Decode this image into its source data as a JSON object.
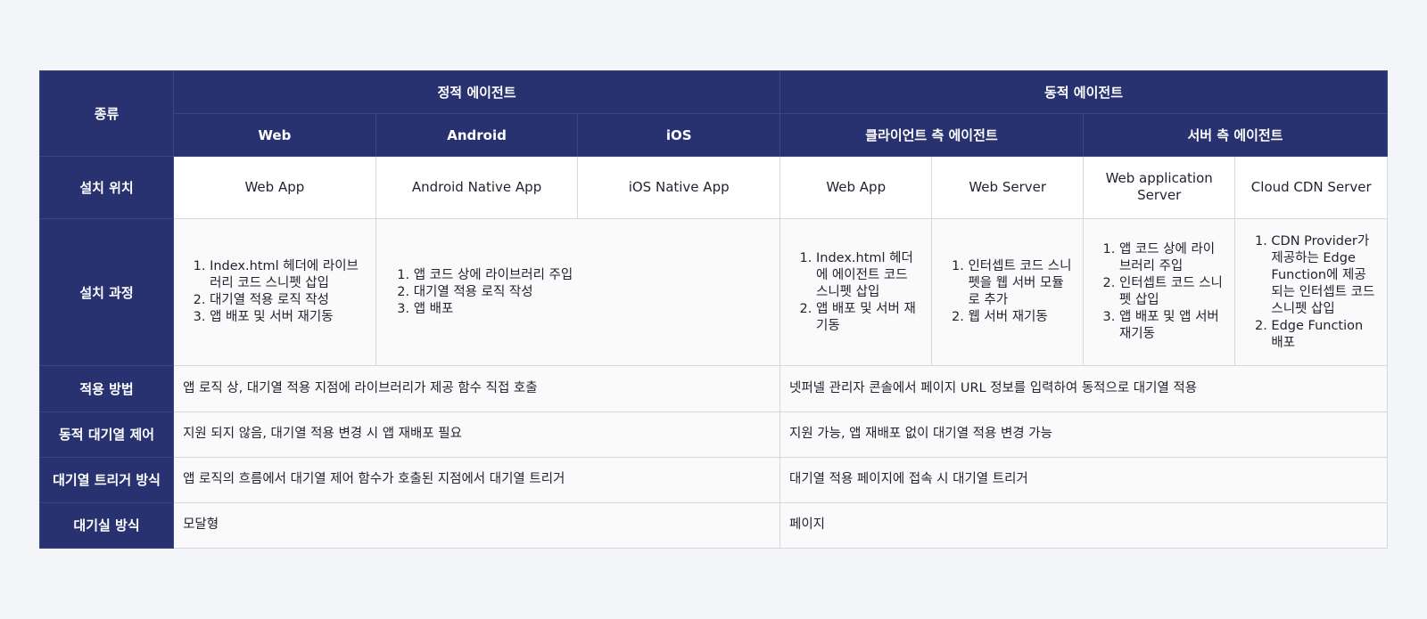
{
  "header": {
    "kind_label": "종류",
    "static_group": "정적 에이전트",
    "dynamic_group": "동적 에이전트",
    "web": "Web",
    "android": "Android",
    "ios": "iOS",
    "client_side": "클라이언트 측 에이전트",
    "server_side": "서버 측 에이전트"
  },
  "rows": {
    "location": {
      "label": "설치 위치",
      "web": "Web App",
      "android": "Android Native App",
      "ios": "iOS Native App",
      "client_web_app": "Web App",
      "client_web_server": "Web Server",
      "server_web_app_server": "Web application Server",
      "server_cloud_cdn": "Cloud CDN Server"
    },
    "process": {
      "label": "설치 과정",
      "web": [
        "Index.html 헤더에 라이브러리 코드 스니펫 삽입",
        "대기열 적용 로직 작성",
        "앱 배포 및 서버 재기동"
      ],
      "mobile": [
        "앱 코드 상에 라이브러리 주입",
        "대기열 적용 로직 작성",
        "앱 배포"
      ],
      "client_web_app": [
        "Index.html 헤더에 에이전트 코드 스니펫 삽입",
        "앱 배포 및 서버 재기동"
      ],
      "client_web_server": [
        "인터셉트 코드 스니펫을 웹 서버 모듈로 추가",
        "웹 서버 재기동"
      ],
      "server_was": [
        "앱 코드 상에 라이브러리 주입",
        "인터셉트 코드 스니펫 삽입",
        "앱 배포 및 앱 서버 재기동"
      ],
      "server_cdn": [
        "CDN Provider가 제공하는 Edge Function에 제공되는 인터셉트 코드 스니펫 삽입",
        "Edge Function 배포"
      ]
    },
    "apply_method": {
      "label": "적용 방법",
      "static": "앱 로직 상, 대기열 적용 지점에 라이브러리가 제공 함수 직접 호출",
      "dynamic": "넷퍼넬 관리자 콘솔에서 페이지 URL 정보를 입력하여 동적으로 대기열 적용"
    },
    "dynamic_control": {
      "label": "동적 대기열 제어",
      "static": "지원 되지 않음, 대기열 적용 변경 시 앱 재배포 필요",
      "dynamic": "지원 가능, 앱 재배포 없이 대기열 적용 변경 가능"
    },
    "trigger": {
      "label": "대기열 트리거 방식",
      "static": "앱 로직의 흐름에서 대기열 제어 함수가 호출된 지점에서 대기열 트리거",
      "dynamic": "대기열 적용 페이지에 접속 시 대기열 트리거"
    },
    "waiting_room": {
      "label": "대기실 방식",
      "static": "모달형",
      "dynamic": "페이지"
    }
  }
}
